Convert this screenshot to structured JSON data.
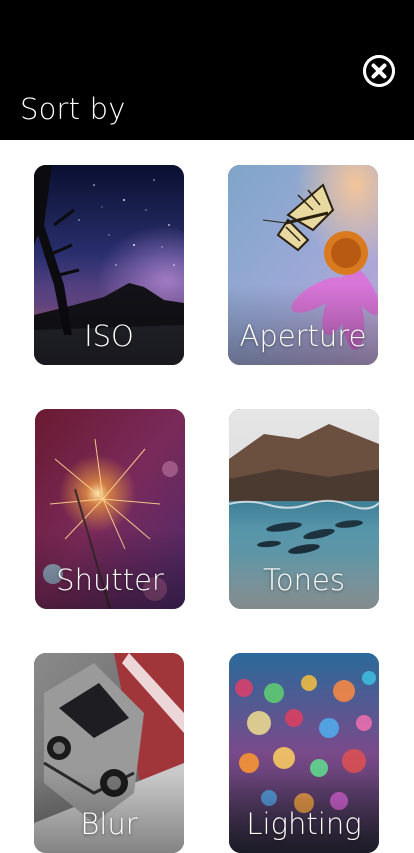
{
  "header": {
    "title": "Sort by",
    "close_icon": "close-circle-icon"
  },
  "categories": [
    {
      "label": "ISO",
      "image": "milky-way-night-sky"
    },
    {
      "label": "Aperture",
      "image": "butterfly-on-coneflower"
    },
    {
      "label": "Shutter",
      "image": "sparkler"
    },
    {
      "label": "Tones",
      "image": "dolphins-under-water"
    },
    {
      "label": "Blur",
      "image": "sports-car-on-track"
    },
    {
      "label": "Lighting",
      "image": "bokeh-string-lights"
    }
  ]
}
